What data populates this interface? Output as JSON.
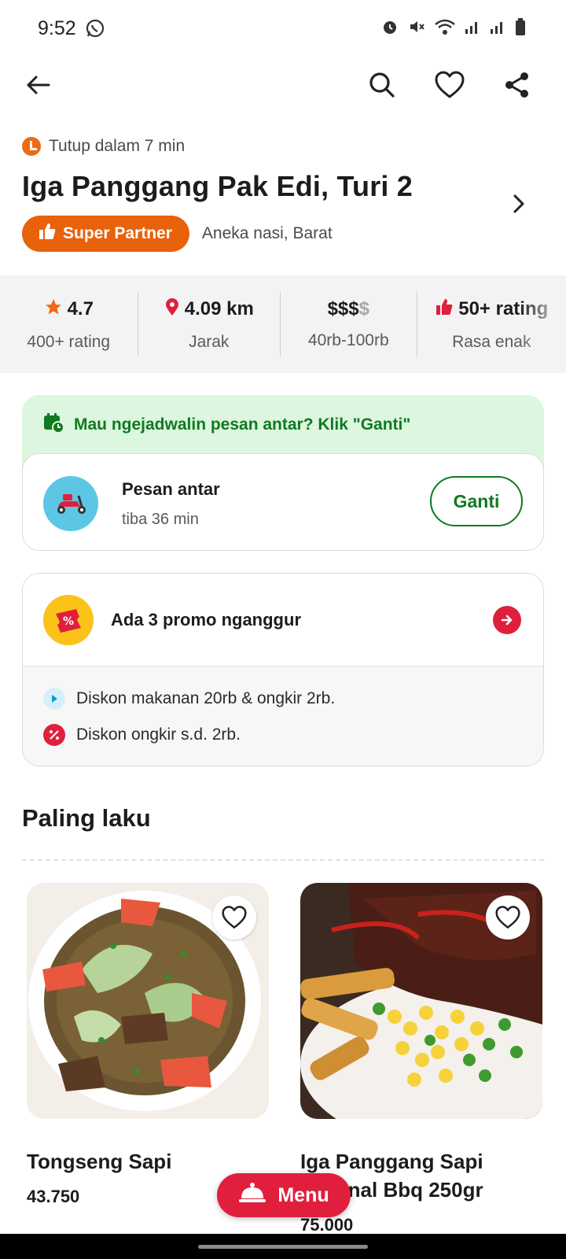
{
  "status_bar": {
    "time": "9:52"
  },
  "header": {
    "closing_text": "Tutup dalam 7 min",
    "name": "Iga Panggang Pak Edi, Turi 2",
    "badge": "Super Partner",
    "cuisine": "Aneka nasi, Barat"
  },
  "stats": {
    "rating_value": "4.7",
    "rating_label": "400+ rating",
    "distance_value": "4.09 km",
    "distance_label": "Jarak",
    "price_level_active": "$$$",
    "price_level_inactive": "$",
    "price_label": "40rb-100rb",
    "taste_value": "50+ rating",
    "taste_label": "Rasa enak"
  },
  "schedule": {
    "banner": "Mau ngejadwalin pesan antar? Klik \"Ganti\"",
    "delivery_title": "Pesan antar",
    "delivery_eta": "tiba 36 min",
    "change_button": "Ganti"
  },
  "promo": {
    "title": "Ada 3 promo nganggur",
    "items": [
      "Diskon makanan 20rb & ongkir 2rb.",
      "Diskon ongkir s.d. 2rb."
    ]
  },
  "section": {
    "title": "Paling laku"
  },
  "items": [
    {
      "name": "Tongseng Sapi",
      "price": "43.750"
    },
    {
      "name": "Iga Panggang Sapi Original Bbq 250gr",
      "price": "75.000"
    }
  ],
  "fab": {
    "label": "Menu"
  },
  "colors": {
    "brand_orange": "#e8620c",
    "accent_red": "#e01f3d",
    "green": "#0f7a1e"
  }
}
